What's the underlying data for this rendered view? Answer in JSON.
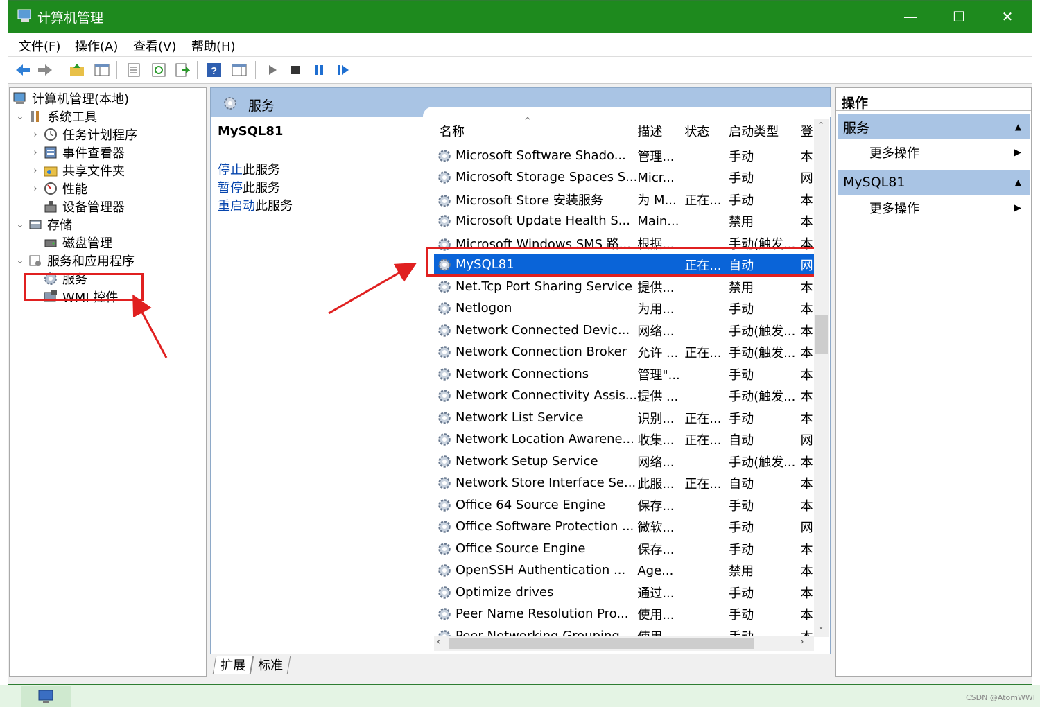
{
  "window": {
    "title": "计算机管理",
    "minimize": "—",
    "maximize": "☐",
    "close": "✕"
  },
  "menu": [
    "文件(F)",
    "操作(A)",
    "查看(V)",
    "帮助(H)"
  ],
  "tree": {
    "root": "计算机管理(本地)",
    "system_tools": "系统工具",
    "task_scheduler": "任务计划程序",
    "event_viewer": "事件查看器",
    "shared_folders": "共享文件夹",
    "performance": "性能",
    "device_manager": "设备管理器",
    "storage": "存储",
    "disk_mgmt": "磁盘管理",
    "services_apps": "服务和应用程序",
    "services": "服务",
    "wmi": "WMI 控件"
  },
  "center": {
    "header_title": "服务",
    "selected_name": "MySQL81",
    "actions": [
      {
        "link": "停止",
        "text": "此服务"
      },
      {
        "link": "暂停",
        "text": "此服务"
      },
      {
        "link": "重启动",
        "text": "此服务"
      }
    ],
    "columns": [
      "名称",
      "描述",
      "状态",
      "启动类型",
      "登"
    ],
    "rows": [
      {
        "name": "Microsoft Software Shado...",
        "desc": "管理...",
        "status": "",
        "startup": "手动",
        "logon": "本"
      },
      {
        "name": "Microsoft Storage Spaces S...",
        "desc": "Micr...",
        "status": "",
        "startup": "手动",
        "logon": "网"
      },
      {
        "name": "Microsoft Store 安装服务",
        "desc": "为 M...",
        "status": "正在...",
        "startup": "手动",
        "logon": "本"
      },
      {
        "name": "Microsoft Update Health S...",
        "desc": "Main...",
        "status": "",
        "startup": "禁用",
        "logon": "本"
      },
      {
        "name": "Microsoft Windows SMS 路...",
        "desc": "根据...",
        "status": "",
        "startup": "手动(触发...",
        "logon": "本"
      },
      {
        "name": "MySQL81",
        "desc": "",
        "status": "正在...",
        "startup": "自动",
        "logon": "网",
        "selected": true
      },
      {
        "name": "Net.Tcp Port Sharing Service",
        "desc": "提供...",
        "status": "",
        "startup": "禁用",
        "logon": "本"
      },
      {
        "name": "Netlogon",
        "desc": "为用...",
        "status": "",
        "startup": "手动",
        "logon": "本"
      },
      {
        "name": "Network Connected Devic...",
        "desc": "网络...",
        "status": "",
        "startup": "手动(触发...",
        "logon": "本"
      },
      {
        "name": "Network Connection Broker",
        "desc": "允许 ...",
        "status": "正在...",
        "startup": "手动(触发...",
        "logon": "本"
      },
      {
        "name": "Network Connections",
        "desc": "管理\"...",
        "status": "",
        "startup": "手动",
        "logon": "本"
      },
      {
        "name": "Network Connectivity Assis...",
        "desc": "提供 ...",
        "status": "",
        "startup": "手动(触发...",
        "logon": "本"
      },
      {
        "name": "Network List Service",
        "desc": "识别...",
        "status": "正在...",
        "startup": "手动",
        "logon": "本"
      },
      {
        "name": "Network Location Awarene...",
        "desc": "收集...",
        "status": "正在...",
        "startup": "自动",
        "logon": "网"
      },
      {
        "name": "Network Setup Service",
        "desc": "网络...",
        "status": "",
        "startup": "手动(触发...",
        "logon": "本"
      },
      {
        "name": "Network Store Interface Se...",
        "desc": "此服...",
        "status": "正在...",
        "startup": "自动",
        "logon": "本"
      },
      {
        "name": "Office 64 Source Engine",
        "desc": "保存...",
        "status": "",
        "startup": "手动",
        "logon": "本"
      },
      {
        "name": "Office Software Protection ...",
        "desc": "微软...",
        "status": "",
        "startup": "手动",
        "logon": "网"
      },
      {
        "name": "Office Source Engine",
        "desc": "保存...",
        "status": "",
        "startup": "手动",
        "logon": "本"
      },
      {
        "name": "OpenSSH Authentication ...",
        "desc": "Age...",
        "status": "",
        "startup": "禁用",
        "logon": "本"
      },
      {
        "name": "Optimize drives",
        "desc": "通过...",
        "status": "",
        "startup": "手动",
        "logon": "本"
      },
      {
        "name": "Peer Name Resolution Pro...",
        "desc": "使用...",
        "status": "",
        "startup": "手动",
        "logon": "本"
      },
      {
        "name": "Peer Networking Grouping",
        "desc": "使用...",
        "status": "",
        "startup": "手动",
        "logon": "本"
      }
    ],
    "tabs": [
      "扩展",
      "标准"
    ]
  },
  "right": {
    "title": "操作",
    "section1": "服务",
    "more1": "更多操作",
    "section2": "MySQL81",
    "more2": "更多操作"
  },
  "watermark": "CSDN @AtomWWl",
  "colors": {
    "titlebar": "#1e8a1e",
    "selection": "#0a64d8",
    "header": "#a9c4e4",
    "annotation": "#e02020"
  }
}
